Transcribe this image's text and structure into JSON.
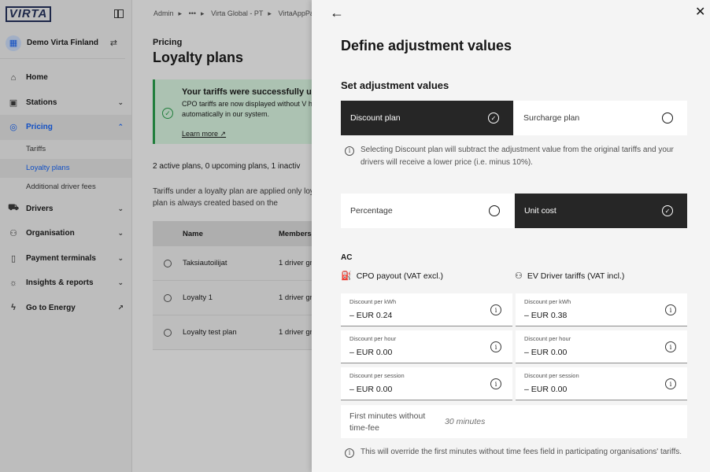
{
  "sidebar": {
    "logo": "VIRTA",
    "org_name": "Demo Virta Finland",
    "org_avatar_icon": "building-icon",
    "items": [
      {
        "label": "Home",
        "icon": "home-icon"
      },
      {
        "label": "Stations",
        "icon": "station-icon"
      },
      {
        "label": "Pricing",
        "icon": "pricing-icon"
      },
      {
        "label": "Drivers",
        "icon": "drivers-icon"
      },
      {
        "label": "Organisation",
        "icon": "organisation-icon"
      },
      {
        "label": "Payment terminals",
        "icon": "terminal-icon"
      },
      {
        "label": "Insights & reports",
        "icon": "lightbulb-icon"
      },
      {
        "label": "Go to Energy",
        "icon": "energy-icon"
      }
    ],
    "pricing_sub": [
      "Tariffs",
      "Loyalty plans",
      "Additional driver fees"
    ]
  },
  "main": {
    "breadcrumb": [
      "Admin",
      "•••",
      "Virta Global - PT",
      "VirtaAppPa"
    ],
    "page_subtitle": "Pricing",
    "page_title": "Loyalty plans",
    "notification": {
      "title": "Your tariffs were successfully upd",
      "body": "CPO tariffs are now displayed without V handled automatically in our system.",
      "link": "Learn more"
    },
    "summary": "2 active plans, 0 upcoming plans, 1 inactiv",
    "description": "Tariffs under a loyalty plan are applied only loyalty plan is always created based on the",
    "table": {
      "headers": [
        "Name",
        "Members"
      ],
      "rows": [
        {
          "name": "Taksiautoilijat",
          "members": "1 driver gr"
        },
        {
          "name": "Loyalty 1",
          "members": "1 driver gr"
        },
        {
          "name": "Loyalty test plan",
          "members": "1 driver gr"
        }
      ]
    }
  },
  "panel": {
    "title": "Define adjustment values",
    "section_title": "Set adjustment values",
    "plan_options": {
      "discount": "Discount plan",
      "surcharge": "Surcharge plan",
      "selected": "discount"
    },
    "plan_info": "Selecting Discount plan will subtract the adjustment value from the original tariffs and your drivers will receive a lower price (i.e. minus 10%).",
    "type_options": {
      "percentage": "Percentage",
      "unit_cost": "Unit cost",
      "selected": "unit_cost"
    },
    "ac_label": "AC",
    "cpo_heading": "CPO payout (VAT excl.)",
    "ev_heading": "EV Driver tariffs (VAT incl.)",
    "cpo_fields": [
      {
        "label": "Discount per kWh",
        "value": "– EUR 0.24"
      },
      {
        "label": "Discount per hour",
        "value": "– EUR 0.00"
      },
      {
        "label": "Discount per session",
        "value": "– EUR 0.00"
      }
    ],
    "ev_fields": [
      {
        "label": "Discount per kWh",
        "value": "– EUR 0.38"
      },
      {
        "label": "Discount per hour",
        "value": "– EUR 0.00"
      },
      {
        "label": "Discount per session",
        "value": "– EUR 0.00"
      }
    ],
    "free_minutes_label": "First minutes without time-fee",
    "free_minutes_value": "30 minutes",
    "override_info": "This will override the first minutes without time fees field in participating organisations' tariffs."
  },
  "colors": {
    "accent": "#0f62fe",
    "selected_tile": "#262626",
    "success": "#24a148"
  }
}
